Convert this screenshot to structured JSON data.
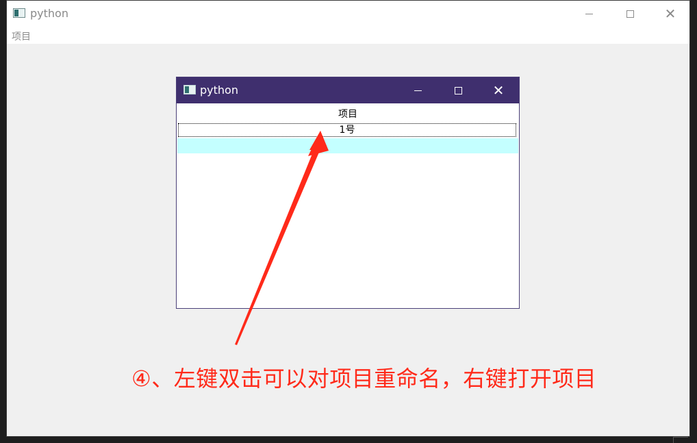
{
  "outer_window": {
    "title": "python",
    "menu": {
      "item_label": "项目"
    },
    "icon": "app-window-icon"
  },
  "inner_window": {
    "title": "python",
    "icon": "app-window-icon",
    "title_bar_color": "#3f2f6e",
    "list": {
      "header": "项目",
      "items": [
        "1号"
      ],
      "hover_row_color": "#c4ffff"
    }
  },
  "annotation": {
    "text": "④、左键双击可以对项目重命名，右键打开项目",
    "color": "#ff2a1a"
  }
}
